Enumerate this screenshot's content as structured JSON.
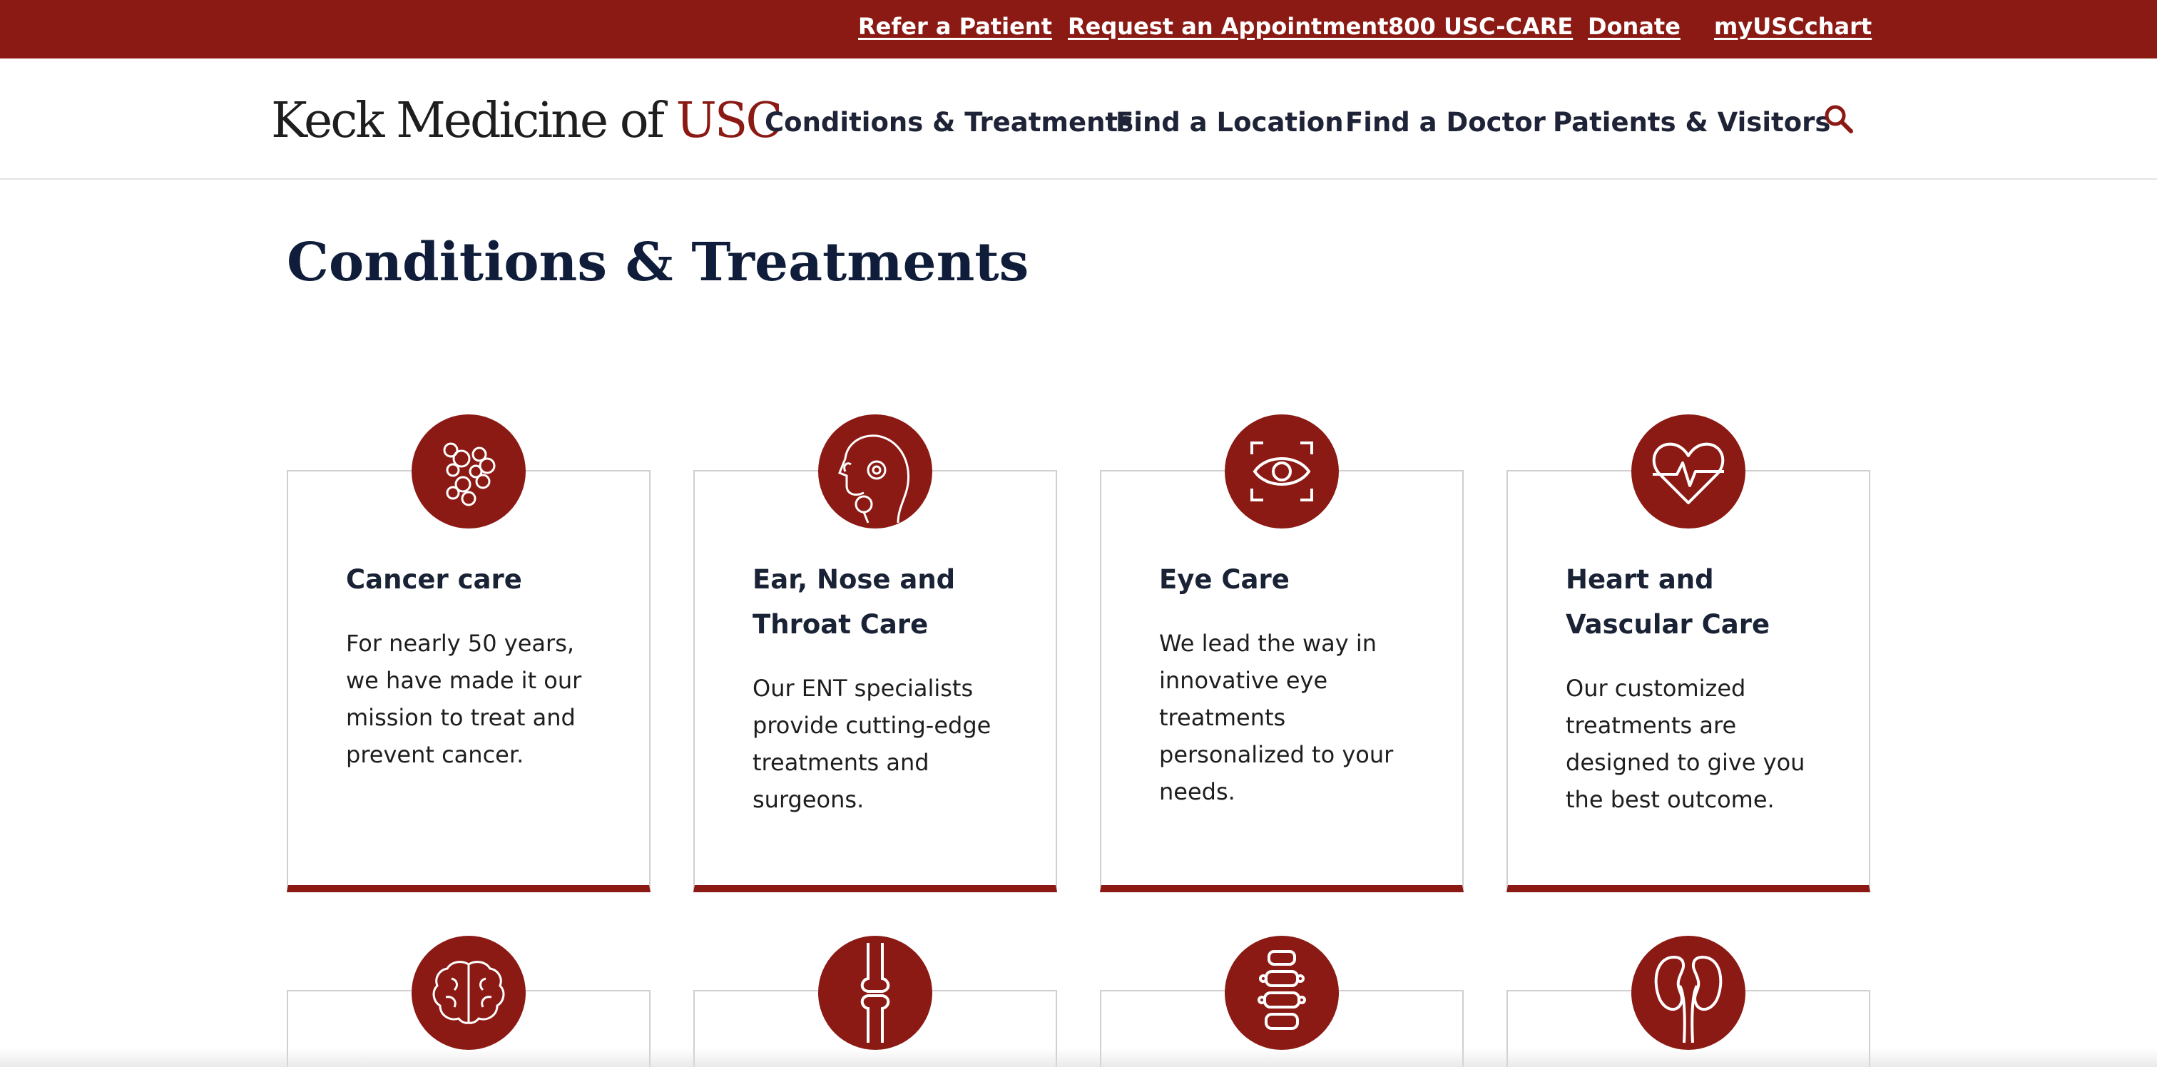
{
  "utility_bar": {
    "links": [
      {
        "label": "Refer a Patient"
      },
      {
        "label": "Request an Appointment"
      },
      {
        "label": "800 USC-CARE"
      },
      {
        "label": "Donate"
      },
      {
        "label": "myUSCchart"
      }
    ],
    "background_color": "#8b1a14"
  },
  "header": {
    "logo_prefix": "Keck Medicine of ",
    "logo_accent": "USC",
    "nav": [
      {
        "label": "Conditions & Treatments"
      },
      {
        "label": "Find a Location"
      },
      {
        "label": "Find a Doctor"
      },
      {
        "label": "Patients & Visitors"
      }
    ],
    "search_icon": "search-icon"
  },
  "main": {
    "title": "Conditions & Treatments",
    "cards": [
      {
        "title": "Cancer care",
        "description": "For nearly 50 years, we have made it our mission to treat and prevent cancer.",
        "icon": "cells-icon"
      },
      {
        "title": "Ear, Nose and Throat Care",
        "description": "Our ENT specialists provide cutting-edge treatments and surgeons.",
        "icon": "head-profile-icon"
      },
      {
        "title": "Eye Care",
        "description": "We lead the way in innovative eye treatments personalized to your needs.",
        "icon": "eye-icon"
      },
      {
        "title": "Heart and Vascular Care",
        "description": "Our customized treatments are designed to give you the best outcome.",
        "icon": "heart-pulse-icon"
      }
    ],
    "second_row_icons": [
      "brain-icon",
      "knee-joint-icon",
      "spine-icon",
      "kidneys-icon"
    ]
  },
  "colors": {
    "accent": "#8b1a14",
    "heading": "#0f1d3a",
    "card_border": "#cfcfcf"
  }
}
